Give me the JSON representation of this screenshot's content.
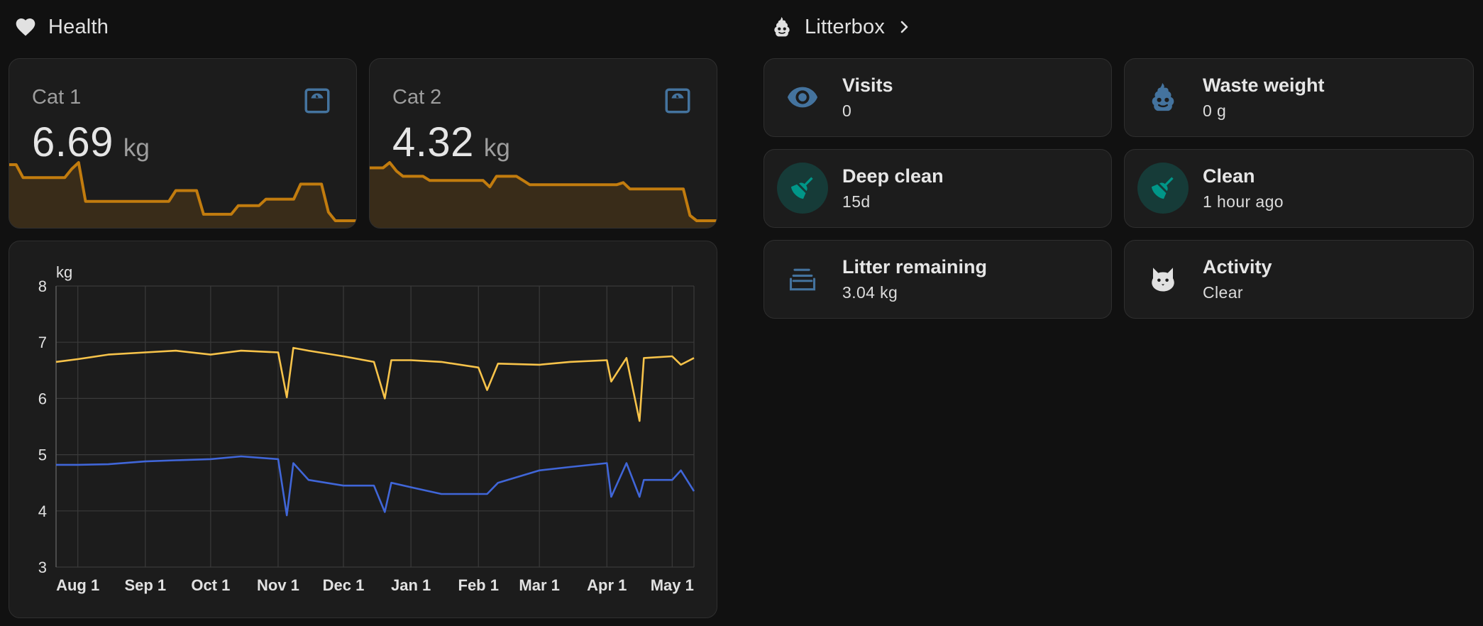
{
  "health": {
    "title": "Health",
    "icon": "heart-icon",
    "cats": [
      {
        "name": "Cat 1",
        "value": "6.69",
        "unit": "kg",
        "icon": "scale-icon",
        "icon_color": "#44739e",
        "sparkline_color": "#c27c0e",
        "sparkline": [
          6.79,
          6.79,
          6.73,
          6.73,
          6.73,
          6.73,
          6.73,
          6.73,
          6.73,
          6.77,
          6.8,
          6.62,
          6.62,
          6.62,
          6.62,
          6.62,
          6.62,
          6.62,
          6.62,
          6.62,
          6.62,
          6.62,
          6.62,
          6.62,
          6.67,
          6.67,
          6.67,
          6.67,
          6.56,
          6.56,
          6.56,
          6.56,
          6.56,
          6.6,
          6.6,
          6.6,
          6.6,
          6.63,
          6.63,
          6.63,
          6.63,
          6.63,
          6.7,
          6.7,
          6.7,
          6.7,
          6.57,
          6.53,
          6.53,
          6.53,
          6.53
        ]
      },
      {
        "name": "Cat 2",
        "value": "4.32",
        "unit": "kg",
        "icon": "scale-icon",
        "icon_color": "#44739e",
        "sparkline_color": "#c27c0e",
        "sparkline": [
          4.9,
          4.9,
          4.9,
          4.95,
          4.87,
          4.82,
          4.82,
          4.82,
          4.82,
          4.78,
          4.78,
          4.78,
          4.78,
          4.78,
          4.78,
          4.78,
          4.78,
          4.78,
          4.72,
          4.82,
          4.82,
          4.82,
          4.82,
          4.78,
          4.74,
          4.74,
          4.74,
          4.74,
          4.74,
          4.74,
          4.74,
          4.74,
          4.74,
          4.74,
          4.74,
          4.74,
          4.74,
          4.74,
          4.76,
          4.7,
          4.7,
          4.7,
          4.7,
          4.7,
          4.7,
          4.7,
          4.7,
          4.7,
          4.45,
          4.4,
          4.4,
          4.4,
          4.4
        ]
      }
    ]
  },
  "history": {
    "unit_label": "kg",
    "y_ticks": [
      "8",
      "7",
      "6",
      "5",
      "4",
      "3"
    ],
    "x_ticks": [
      "Aug 1",
      "Sep 1",
      "Oct 1",
      "Nov 1",
      "Dec 1",
      "Jan 1",
      "Feb 1",
      "Mar 1",
      "Apr 1",
      "May 1"
    ]
  },
  "chart_data": {
    "type": "line",
    "ylabel": "kg",
    "ylim": [
      3,
      8
    ],
    "grid": true,
    "x": [
      "Jul 22",
      "Aug 1",
      "Aug 15",
      "Sep 1",
      "Sep 15",
      "Oct 1",
      "Oct 15",
      "Nov 1",
      "Nov 5",
      "Nov 8",
      "Nov 15",
      "Dec 1",
      "Dec 15",
      "Dec 20",
      "Dec 23",
      "Jan 1",
      "Jan 15",
      "Feb 1",
      "Feb 5",
      "Feb 10",
      "Mar 1",
      "Mar 15",
      "Apr 1",
      "Apr 3",
      "Apr 10",
      "Apr 16",
      "Apr 18",
      "May 1",
      "May 5",
      "May 11"
    ],
    "series": [
      {
        "color": "#f7c34a",
        "values": [
          6.65,
          6.7,
          6.78,
          6.82,
          6.85,
          6.78,
          6.85,
          6.82,
          6.02,
          6.9,
          6.85,
          6.75,
          6.65,
          6.0,
          6.68,
          6.68,
          6.65,
          6.55,
          6.15,
          6.62,
          6.6,
          6.65,
          6.68,
          6.3,
          6.72,
          5.6,
          6.72,
          6.75,
          6.6,
          6.72
        ]
      },
      {
        "color": "#4066d8",
        "values": [
          4.82,
          4.82,
          4.83,
          4.88,
          4.9,
          4.92,
          4.97,
          4.92,
          3.92,
          4.85,
          4.55,
          4.45,
          4.45,
          3.98,
          4.5,
          4.42,
          4.3,
          4.3,
          4.3,
          4.5,
          4.72,
          4.78,
          4.85,
          4.25,
          4.85,
          4.25,
          4.55,
          4.55,
          4.72,
          4.35
        ]
      }
    ]
  },
  "litterbox": {
    "title": "Litterbox",
    "icon": "litterbox-icon",
    "tiles": [
      {
        "name": "Visits",
        "state": "0",
        "icon": "eye-icon",
        "icon_color": "#44739e",
        "round_bg": false
      },
      {
        "name": "Waste weight",
        "state": "0 g",
        "icon": "poop-icon",
        "icon_color": "#44739e",
        "round_bg": false
      },
      {
        "name": "Deep clean",
        "state": "15d",
        "icon": "broom-icon",
        "icon_color": "#009688",
        "round_bg": true
      },
      {
        "name": "Clean",
        "state": "1 hour ago",
        "icon": "broom-icon",
        "icon_color": "#009688",
        "round_bg": true
      },
      {
        "name": "Litter remaining",
        "state": "3.04 kg",
        "icon": "layers-icon",
        "icon_color": "#44739e",
        "round_bg": false
      },
      {
        "name": "Activity",
        "state": "Clear",
        "icon": "cat-icon",
        "icon_color": "#e1e1e1",
        "round_bg": false
      }
    ]
  }
}
